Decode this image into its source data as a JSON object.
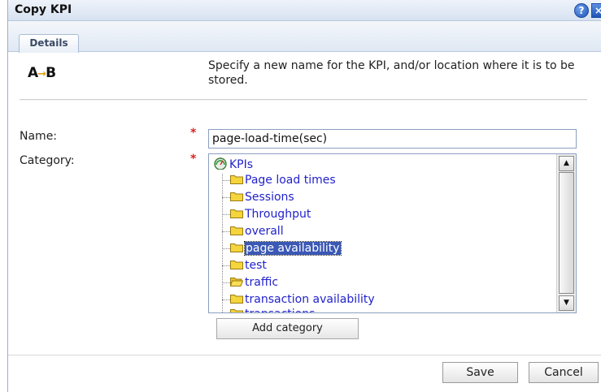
{
  "dialog": {
    "title": "Copy KPI",
    "help_glyph": "?",
    "close_glyph": "×"
  },
  "tabs": [
    {
      "label": "Details",
      "active": true
    }
  ],
  "logo": {
    "icon": "a-to-b-logo",
    "text_a": "A",
    "text_b": "B"
  },
  "instruction": "Specify a new name for the KPI, and/or location where it is to be stored.",
  "form": {
    "name_label": "Name:",
    "name_value": "page-load-time(sec)",
    "category_label": "Category:",
    "required_mark": "*"
  },
  "tree": {
    "root": {
      "label": "KPIs",
      "icon": "gauge-icon"
    },
    "items": [
      {
        "label": "Page load times",
        "icon": "folder-icon",
        "selected": false
      },
      {
        "label": "Sessions",
        "icon": "folder-icon",
        "selected": false
      },
      {
        "label": "Throughput",
        "icon": "folder-icon",
        "selected": false
      },
      {
        "label": "overall",
        "icon": "folder-icon",
        "selected": false
      },
      {
        "label": "page availability",
        "icon": "folder-icon",
        "selected": true
      },
      {
        "label": "test",
        "icon": "folder-icon",
        "selected": false
      },
      {
        "label": "traffic",
        "icon": "open-folder-icon",
        "selected": false
      },
      {
        "label": "transaction availability",
        "icon": "folder-icon",
        "selected": false
      },
      {
        "label": "transactions",
        "icon": "folder-icon",
        "selected": false
      }
    ]
  },
  "buttons": {
    "add_category": "Add category",
    "save": "Save",
    "cancel": "Cancel"
  },
  "colors": {
    "link_blue": "#2222cc",
    "selection": "#3a58b5",
    "required_red": "#dd2222",
    "folder_yellow": "#f5d53c"
  }
}
